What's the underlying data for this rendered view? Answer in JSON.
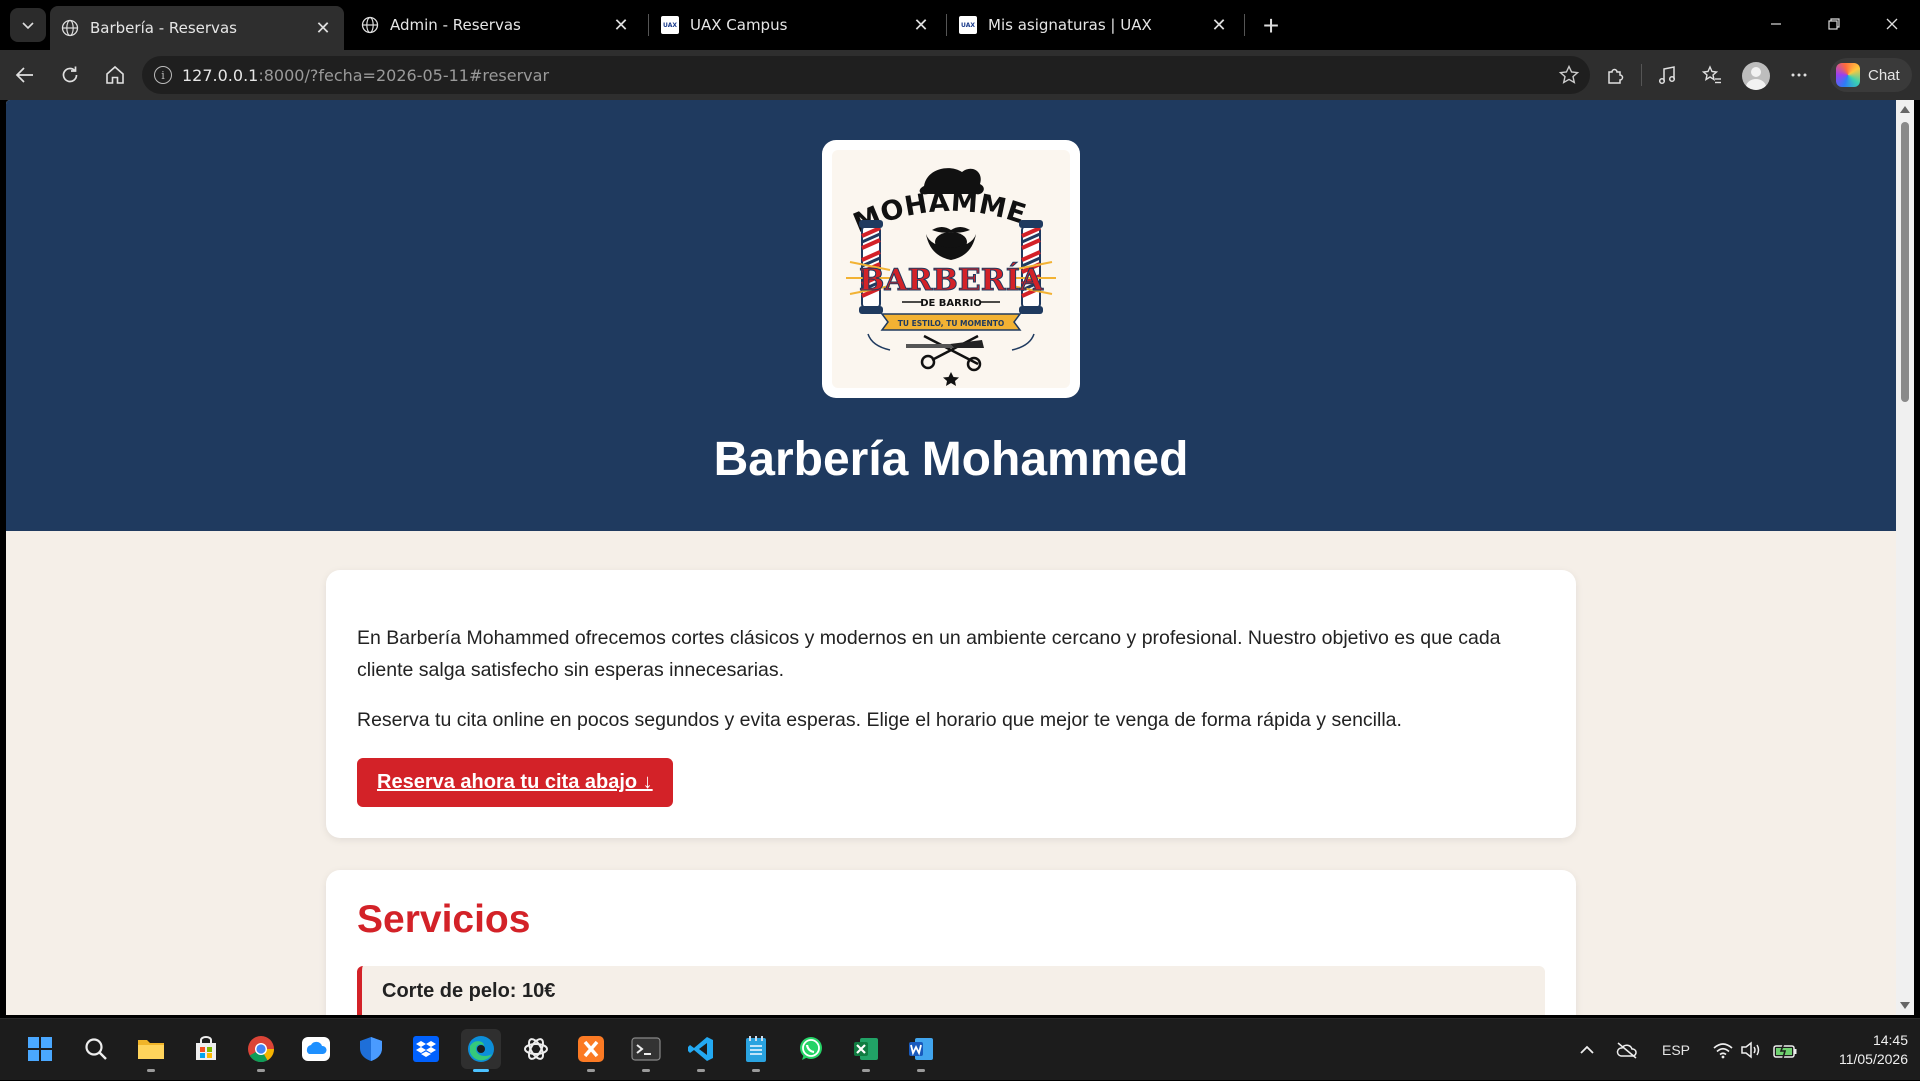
{
  "browser": {
    "tabs": [
      {
        "label": "Barbería - Reservas",
        "active": true
      },
      {
        "label": "Admin - Reservas",
        "active": false
      },
      {
        "label": "UAX Campus",
        "active": false
      },
      {
        "label": "Mis asignaturas | UAX",
        "active": false
      }
    ],
    "url_host": "127.0.0.1",
    "url_rest": ":8000/?fecha=2026-05-11#reservar",
    "chat_label": "Chat"
  },
  "page": {
    "logo": {
      "line1": "MOHAMMED",
      "line2": "BARBERÍA",
      "line3": "DE BARRIO",
      "ribbon": "TU ESTILO, TU MOMENTO"
    },
    "title": "Barbería Mohammed",
    "intro": {
      "paragraph1": "En Barbería Mohammed ofrecemos cortes clásicos y modernos en un ambiente cercano y profesional. Nuestro objetivo es que cada cliente salga satisfecho sin esperas innecesarias.",
      "paragraph2": "Reserva tu cita online en pocos segundos y evita esperas. Elige el horario que mejor te venga de forma rápida y sencilla.",
      "cta": "Reserva ahora tu cita abajo ↓"
    },
    "services": {
      "heading": "Servicios",
      "items": [
        {
          "label": "Corte de pelo: 10€"
        }
      ]
    },
    "colors": {
      "hero_bg": "#1f3a5f",
      "accent_red": "#d32228",
      "page_bg": "#f5efe8"
    }
  },
  "taskbar": {
    "language": "ESP",
    "time": "14:45",
    "date": "11/05/2026",
    "apps": [
      "start-icon",
      "search-icon",
      "file-explorer-icon",
      "store-icon",
      "chrome-icon",
      "onedrive-icon",
      "defender-icon",
      "dropbox-icon",
      "edge-icon",
      "chatgpt-icon",
      "xampp-icon",
      "terminal-icon",
      "vscode-icon",
      "notepad-icon",
      "whatsapp-icon",
      "excel-icon",
      "word-icon"
    ]
  }
}
